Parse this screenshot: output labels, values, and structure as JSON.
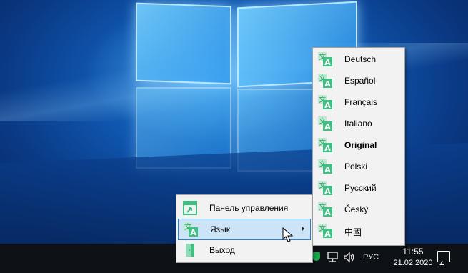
{
  "context_menu": {
    "items": [
      {
        "label": "Панель управления",
        "icon": "control-panel-icon"
      },
      {
        "label": "Язык",
        "icon": "language-icon",
        "has_submenu": true,
        "highlighted": true
      },
      {
        "label": "Выход",
        "icon": "exit-door-icon"
      }
    ]
  },
  "language_submenu": {
    "items": [
      {
        "label": "Deutsch"
      },
      {
        "label": "Español"
      },
      {
        "label": "Français"
      },
      {
        "label": "Italiano"
      },
      {
        "label": "Original",
        "selected": true
      },
      {
        "label": "Polski"
      },
      {
        "label": "Русский"
      },
      {
        "label": "Český"
      },
      {
        "label": "中國"
      }
    ]
  },
  "taskbar": {
    "input_language": "РУС",
    "clock_time": "11:55",
    "clock_date": "21.02.2020"
  },
  "colors": {
    "menu_background": "#f2f2f2",
    "highlight": "#cce4f7",
    "highlight_border": "#2d7fd0",
    "icon_green": "#3fbf84",
    "taskbar": "#0e1116"
  }
}
